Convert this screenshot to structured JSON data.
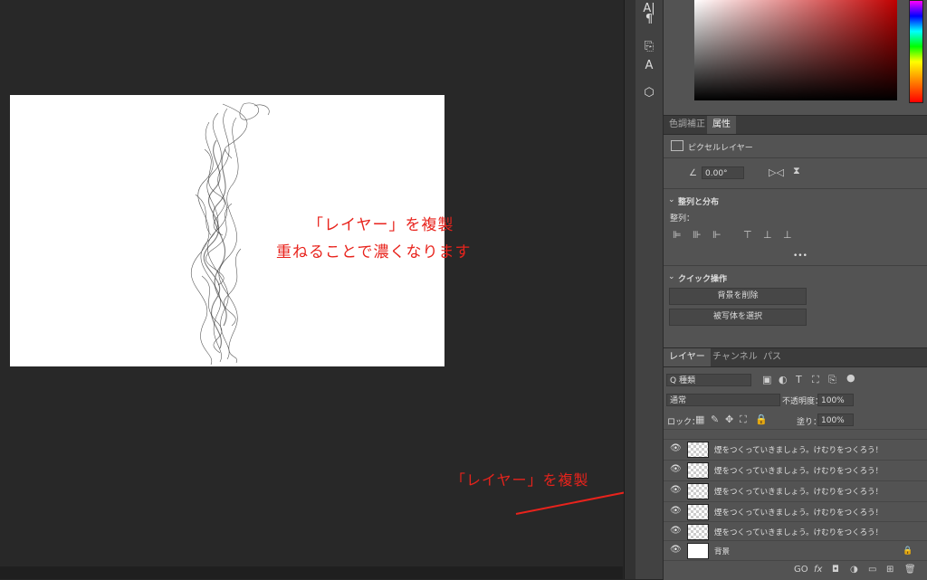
{
  "canvas": {
    "annotation_line1": "「レイヤー」を複製",
    "annotation_line2": "重ねることで濃くなります",
    "side_annotation": "「レイヤー」を複製",
    "annotation_color": "#e8231c"
  },
  "tools": {
    "icons": [
      "text-tool-icon",
      "paragraph-icon",
      "glyph-icon",
      "character-style-icon",
      "3d-cube-icon"
    ],
    "glyphs": [
      "A|",
      "¶",
      "⎘",
      "A",
      "⬡"
    ]
  },
  "properties_panel": {
    "tabs": [
      "色調補正",
      "属性"
    ],
    "layer_kind": "ピクセルレイヤー",
    "angle": "0.00°",
    "align_section": "整列と分布",
    "align_label": "整列：",
    "more": "•••",
    "quick_section": "クイック操作",
    "remove_bg_button": "背景を削除",
    "select_subject_button": "被写体を選択"
  },
  "layers_panel": {
    "tabs": [
      "レイヤー",
      "チャンネル",
      "パス"
    ],
    "filter_kind": "Q 種類",
    "blend_mode": "通常",
    "opacity_label": "不透明度：",
    "opacity_value": "100%",
    "lock_label": "ロック：",
    "fill_label": "塗り：",
    "fill_value": "100%",
    "layers": [
      {
        "name": "煙をつくっていきましょう。けむりをつくろう！"
      },
      {
        "name": "煙をつくっていきましょう。けむりをつくろう！"
      },
      {
        "name": "煙をつくっていきましょう。けむりをつくろう！"
      },
      {
        "name": "煙をつくっていきましょう。けむりをつくろう！"
      },
      {
        "name": "煙をつくっていきましょう。けむりをつくろう！"
      },
      {
        "name": "背景"
      }
    ],
    "footer": [
      "GO",
      "fx",
      "◘",
      "◑",
      "▭",
      "⊞",
      "🗑"
    ]
  }
}
